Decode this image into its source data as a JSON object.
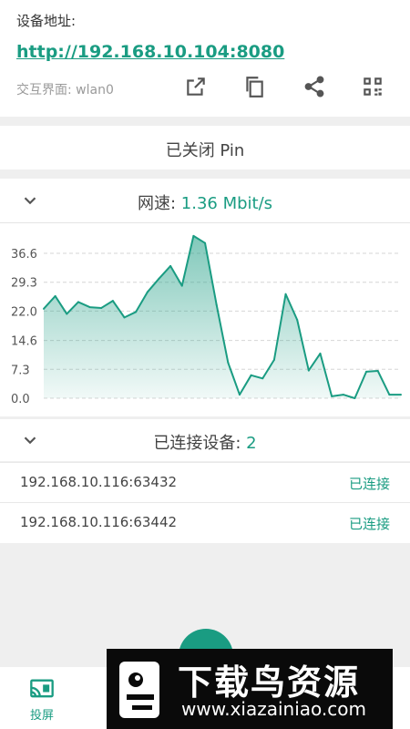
{
  "header": {
    "address_label": "设备地址:",
    "url": "http://192.168.10.104:8080",
    "interface": "交互界面: wlan0",
    "icons": [
      "open-external-icon",
      "copy-icon",
      "share-icon",
      "qr-code-icon"
    ]
  },
  "pin": {
    "status": "已关闭 Pin"
  },
  "speed": {
    "label": "网速: ",
    "value": "1.36 Mbit/s"
  },
  "chart_data": {
    "type": "area",
    "title": "",
    "xlabel": "",
    "ylabel": "",
    "ylim": [
      0.0,
      36.6
    ],
    "yticks": [
      "36.6",
      "29.3",
      "22.0",
      "14.6",
      "7.3",
      "0.0"
    ],
    "grid": true,
    "color": "#1a9c82",
    "values": [
      22.6,
      25.8,
      21.3,
      24.3,
      23.0,
      22.8,
      24.6,
      20.4,
      21.8,
      26.8,
      30.2,
      33.4,
      28.4,
      41.0,
      39.2,
      23.6,
      9.0,
      0.9,
      5.8,
      5.0,
      9.7,
      26.3,
      19.8,
      7.0,
      11.3,
      0.5,
      0.9,
      0.0,
      6.7,
      6.9,
      0.9,
      0.9
    ]
  },
  "devices": {
    "label": "已连接设备: ",
    "count": "2",
    "items": [
      {
        "ip": "192.168.10.116:63432",
        "status": "已连接"
      },
      {
        "ip": "192.168.10.116:63442",
        "status": "已连接"
      }
    ]
  },
  "nav": {
    "cast_label": "投屏"
  },
  "watermark": {
    "title": "下载鸟资源",
    "url": "www.xiazainiao.com"
  }
}
